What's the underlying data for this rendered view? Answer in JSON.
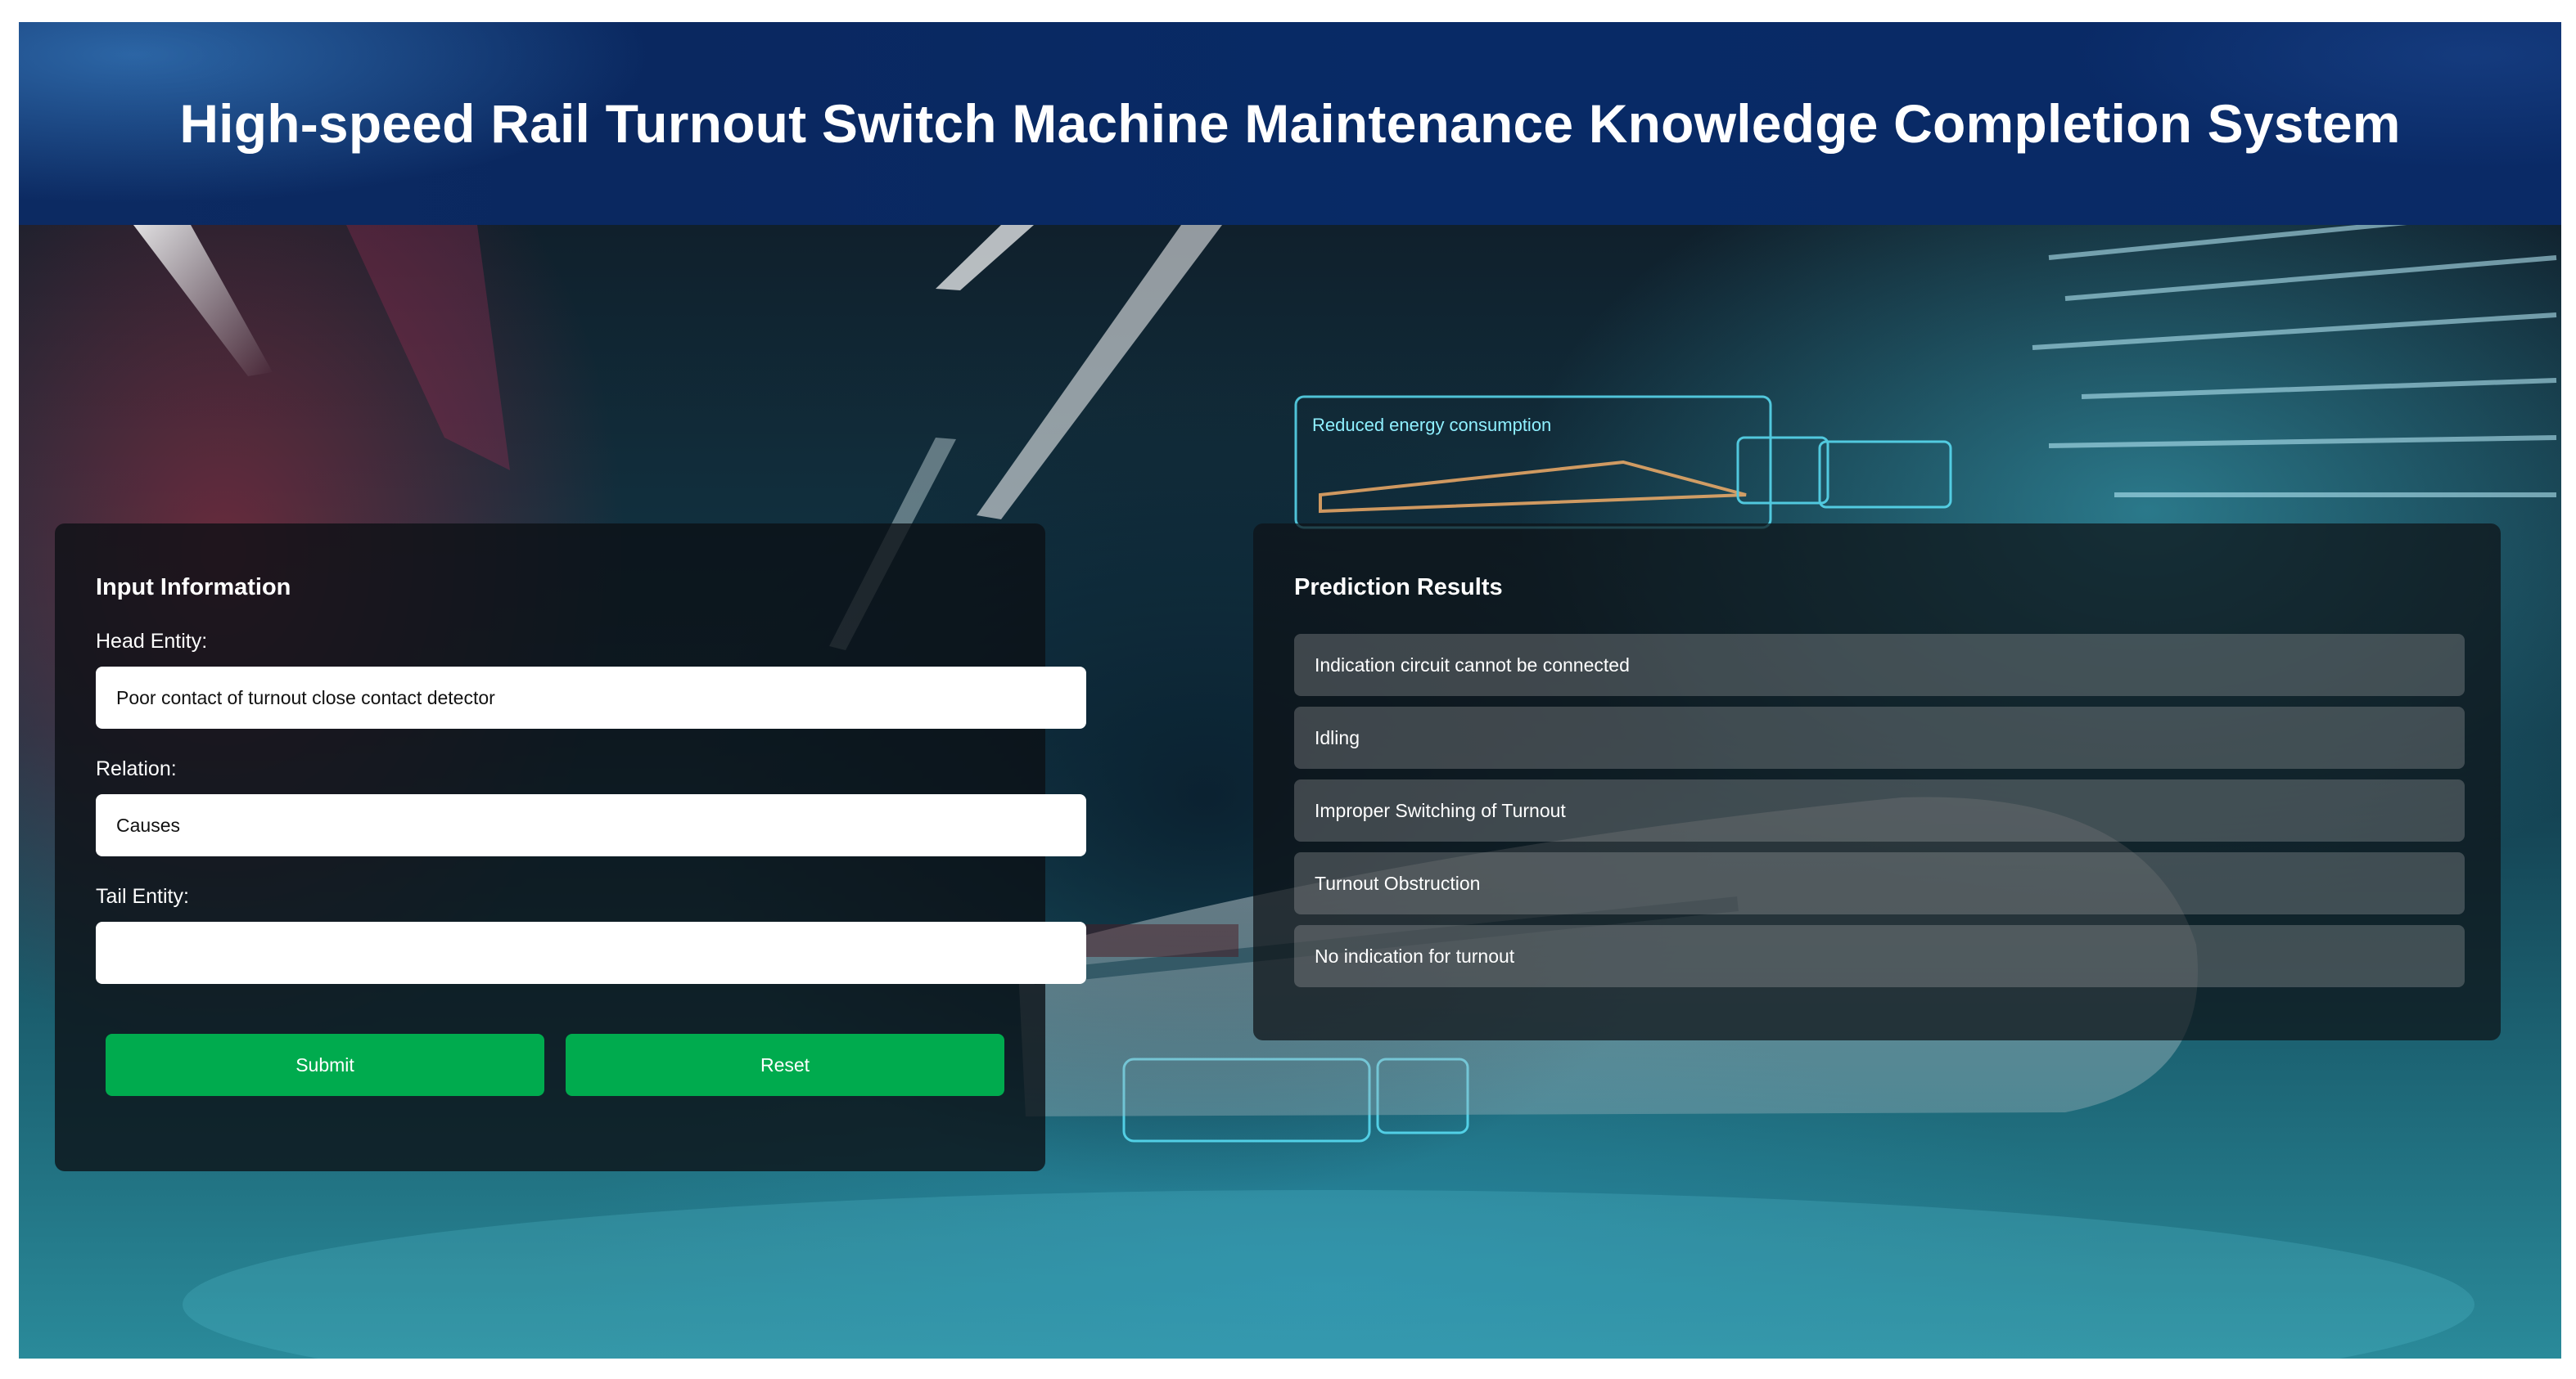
{
  "header": {
    "title": "High-speed Rail Turnout Switch Machine Maintenance Knowledge Completion System"
  },
  "input_panel": {
    "title": "Input Information",
    "head_entity": {
      "label": "Head Entity:",
      "value": "Poor contact of turnout close contact detector"
    },
    "relation": {
      "label": "Relation:",
      "value": "Causes"
    },
    "tail_entity": {
      "label": "Tail Entity:",
      "value": ""
    },
    "submit_label": "Submit",
    "reset_label": "Reset"
  },
  "results_panel": {
    "title": "Prediction Results",
    "items": [
      "Indication circuit cannot be connected",
      "Idling",
      "Improper Switching of Turnout",
      "Turnout Obstruction",
      "No indication for turnout"
    ]
  },
  "background": {
    "overlay_text": "Reduced energy consumption"
  },
  "colors": {
    "header_bg": "#0a2860",
    "button_green": "#00ab4e",
    "panel_bg": "rgba(12,16,20,0.78)"
  }
}
